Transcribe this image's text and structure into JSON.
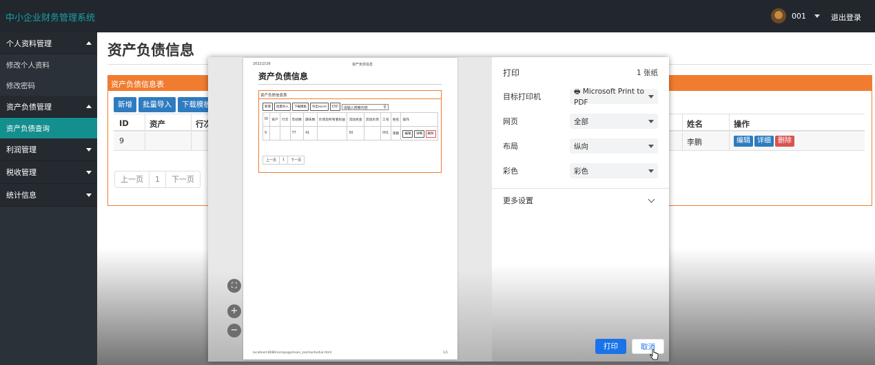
{
  "topbar": {
    "brand": "中小企业财务管理系统",
    "username": "001",
    "logout": "退出登录"
  },
  "sidebar": {
    "groups": [
      {
        "label": "个人资料管理",
        "items": [
          "修改个人资料",
          "修改密码"
        ]
      },
      {
        "label": "资产负债管理",
        "items": [
          "资产负债查询"
        ]
      },
      {
        "label": "利润管理"
      },
      {
        "label": "税收管理"
      },
      {
        "label": "统计信息"
      }
    ]
  },
  "main": {
    "title": "资产负债信息",
    "panel_title": "资产负债信息表",
    "toolbar": {
      "add": "新增",
      "import": "批量导入",
      "download": "下载模板"
    },
    "columns": {
      "id": "ID",
      "asset": "资产",
      "line": "行次",
      "name": "姓名",
      "ops": "操作"
    },
    "row": {
      "id": "9",
      "name": "李鹏",
      "edit": "编辑",
      "detail": "详细",
      "delete": "删除"
    },
    "pager": {
      "prev": "上一页",
      "page": "1",
      "next": "下一页"
    }
  },
  "preview": {
    "date": "2022/2/26",
    "header": "资产负债信息",
    "title": "资产负债信息",
    "panel_title": "资产负债信息表",
    "buttons": [
      "新增",
      "批量导入",
      "下载模板",
      "导出excel",
      "打印"
    ],
    "search_placeholder": "请输入搜索内容",
    "columns": [
      "ID",
      "资产",
      "行次",
      "年初数",
      "期末数",
      "负债及所有者权益",
      "流动资金",
      "流动负债",
      "工号",
      "姓名",
      "操作"
    ],
    "row": [
      "9",
      "",
      "",
      "77",
      "41",
      "",
      "50",
      "",
      "001",
      "李鹏",
      ""
    ],
    "row_ops": [
      "编辑",
      "详细",
      "删除"
    ],
    "pager": [
      "上一页",
      "1",
      "下一页"
    ],
    "footer_url": "localhost:8080/ssm/page/main_zaichanfuzhai.html",
    "footer_page": "1/1"
  },
  "print": {
    "title": "打印",
    "sheets": "1 张纸",
    "printer_label": "目标打印机",
    "printer_value": "Microsoft Print to PDF",
    "pages_label": "网页",
    "pages_value": "全部",
    "layout_label": "布局",
    "layout_value": "纵向",
    "color_label": "彩色",
    "color_value": "彩色",
    "more": "更多设置",
    "print_btn": "打印",
    "cancel_btn": "取消"
  }
}
